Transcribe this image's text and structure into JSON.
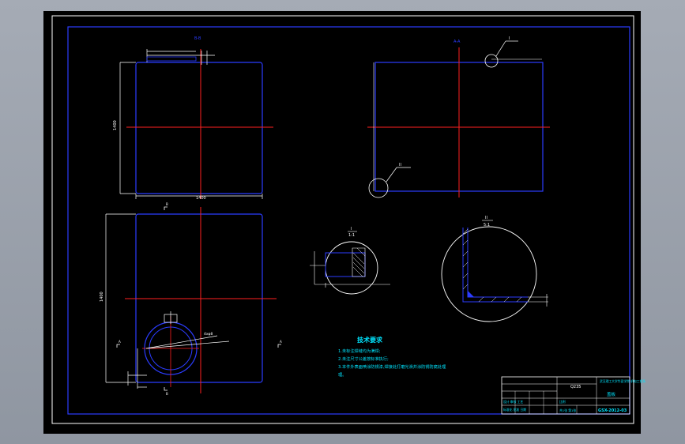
{
  "drawing": {
    "view_tag_top_left": "B-B",
    "view_tag_top_right": "A-A",
    "dim_height_top_left": "1400",
    "dim_width_top_left": "1400",
    "dim_height_bottom_left": "1400",
    "section_mark_left": "A",
    "section_mark_right": "A",
    "section_mark_top": "B",
    "section_mark_bottom": "B",
    "callout_i": "I",
    "callout_ii": "II",
    "detail_i_label": "I",
    "detail_i_scale": "1:1",
    "detail_ii_label": "II",
    "detail_ii_scale": "5:1",
    "hole_callout": "4xφ8",
    "tech_req_title": "技术要求",
    "tech_req_lines": [
      "1.未标注焊缝均为满焊;",
      "2.未注尺寸公差按标准执行;",
      "3.本件外表面喷涂防锈漆,焊接处打磨光滑并涂防锈防腐处理"
    ],
    "tech_req_tail": "理。"
  },
  "title_block": {
    "school": "武汉理工大学华夏学院 机电工程系",
    "part_name": "盖板",
    "material": "Q235",
    "drawing_no": "GSX-2012-03",
    "scale_label": "比例",
    "sheet_label": "共1张 第1张",
    "designer_row": "设计  审核  工艺",
    "approve_row": "标准化  批准  日期"
  }
}
